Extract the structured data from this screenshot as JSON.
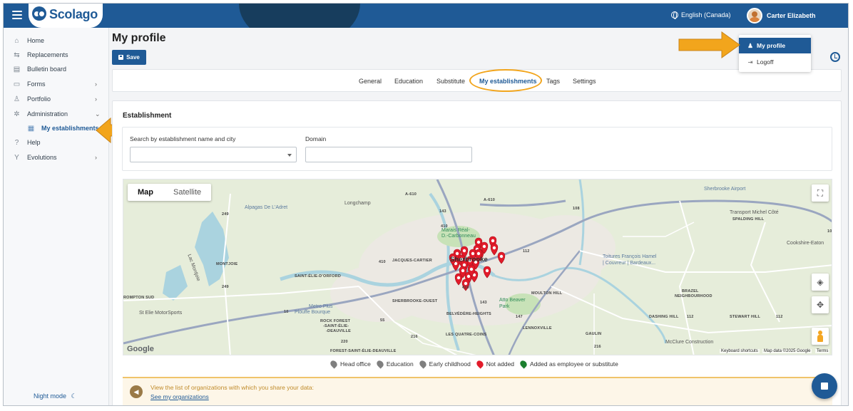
{
  "app": {
    "brand": "Scolago"
  },
  "header": {
    "language": "English (Canada)",
    "user_name": "Carter Elizabeth"
  },
  "user_menu": {
    "items": [
      {
        "label": "My profile",
        "icon": "person-icon",
        "active": true
      },
      {
        "label": "Logoff",
        "icon": "logout-icon",
        "active": false
      }
    ]
  },
  "sidebar": {
    "items": [
      {
        "label": "Home",
        "icon": "home-icon"
      },
      {
        "label": "Replacements",
        "icon": "replacements-icon"
      },
      {
        "label": "Bulletin board",
        "icon": "bulletin-icon"
      },
      {
        "label": "Forms",
        "icon": "forms-icon",
        "has_children": true
      },
      {
        "label": "Portfolio",
        "icon": "trophy-icon",
        "has_children": true
      },
      {
        "label": "Administration",
        "icon": "gear-icon",
        "expanded": true
      },
      {
        "label": "My establishments",
        "icon": "building-icon",
        "sub": true,
        "active": true
      },
      {
        "label": "Help",
        "icon": "help-icon"
      },
      {
        "label": "Evolutions",
        "icon": "evolutions-icon",
        "has_children": true
      }
    ],
    "night_mode": "Night mode"
  },
  "page": {
    "title": "My profile",
    "save_label": "Save"
  },
  "tabs": [
    {
      "label": "General"
    },
    {
      "label": "Education"
    },
    {
      "label": "Substitute"
    },
    {
      "label": "My establishments",
      "active": true
    },
    {
      "label": "Tags"
    },
    {
      "label": "Settings"
    }
  ],
  "establishment": {
    "title": "Establishment",
    "search_label": "Search by establishment name and city",
    "search_value": "",
    "domain_label": "Domain",
    "domain_value": ""
  },
  "map": {
    "type_buttons": [
      "Map",
      "Satellite"
    ],
    "selected_type": "Map",
    "google": "Google",
    "footer": [
      "Keyboard shortcuts",
      "Map data ©2025 Google",
      "Terms"
    ],
    "labels": {
      "longchamp": "Longchamp",
      "alpagas": "Alpagas De L'Adret",
      "marais": "Marais Réal-",
      "marais2": "D.-Carbonneau",
      "sherbrooke": "Sherbrooke",
      "airport": "Sherbrooke Airport",
      "transport": "Transport Michel Côté",
      "cookshire": "Cookshire-Eaton",
      "toitures": "Toitures François Hamel",
      "toitures2": "| Couvreur | Bardeaux...",
      "lac": "Lac Montjoie",
      "stelie": "St Elie MotorSports",
      "metro": "Metro Plus",
      "metro2": "Plouffe Bourque",
      "atto": "Atto Beaver",
      "atto2": "Park",
      "mcclure": "McClure Construction",
      "rockforest": "ROCK FOREST",
      "rockforest2": "-SAINT-ÉLIE-",
      "rockforest3": "-DEAUVILLE",
      "rockforest4": "FOREST-SAINT-ÉLIE-DEAUVILLE",
      "jacques": "JACQUES-CARTIER",
      "montjoie": "MONTJOIE",
      "orford": "SAINT-ÉLIE-D'ORFORD",
      "sherouest": "SHERBROOKE-OUEST",
      "belvedere": "BELVÉDÈRE-HEIGHTS",
      "quatre": "LES QUATRE-COINS",
      "lennox": "LENNOXVILLE",
      "moulton": "MOULTON HILL",
      "brazel": "BRAZEL",
      "brazel2": "NEIGHBOURHOOD",
      "spalding": "SPALDING HILL",
      "dashing": "DASHING HILL",
      "gaulin": "GAULIN",
      "stewart": "STEWART HILL",
      "rompton": "ROMPTON SUD",
      "a610": "A-610",
      "a610b": "A-610",
      "r410": "410",
      "r410b": "410",
      "r410c": "410",
      "r143": "143",
      "r143b": "143",
      "r112": "112",
      "r112b": "112",
      "r112c": "112",
      "r108": "108",
      "r108b": "108",
      "r147": "147",
      "r216": "216",
      "r216b": "216",
      "r220": "220",
      "r249": "249",
      "r249b": "249",
      "r10": "10",
      "r55": "55"
    },
    "pin_count": 24,
    "pin_colors": {
      "not_added": "#e21b2a",
      "head_office": "#7f7f7f",
      "added": "#1b7f2e"
    }
  },
  "legend": [
    {
      "label": "Head office",
      "color": "#7f7f7f"
    },
    {
      "label": "Education",
      "color": "#7f7f7f"
    },
    {
      "label": "Early childhood",
      "color": "#7f7f7f"
    },
    {
      "label": "Not added",
      "color": "#e21b2a"
    },
    {
      "label": "Added as employee or substitute",
      "color": "#1b7f2e"
    }
  ],
  "info": {
    "text": "View the list of organizations with which you share your data:",
    "link": "See my organizations"
  },
  "colors": {
    "primary": "#1f5a96",
    "annotation": "#f2a51c"
  }
}
